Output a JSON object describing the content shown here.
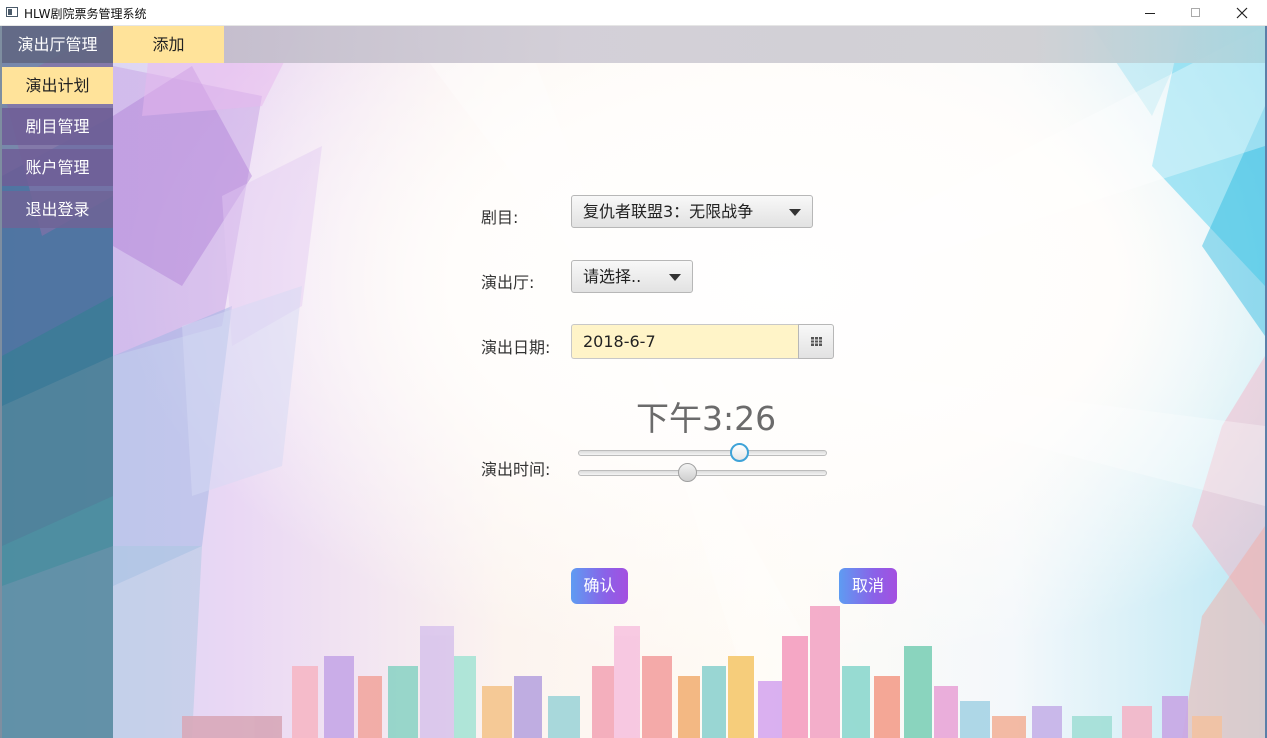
{
  "window": {
    "title": "HLW剧院票务管理系统",
    "controls": [
      "minimize",
      "maximize",
      "close"
    ]
  },
  "topbar": {
    "tabs": [
      {
        "label": "添加",
        "active": true
      }
    ]
  },
  "sidebar": {
    "items": [
      {
        "label": "演出厅管理",
        "active": false
      },
      {
        "label": "演出计划",
        "active": true
      },
      {
        "label": "剧目管理",
        "active": false
      },
      {
        "label": "账户管理",
        "active": false
      },
      {
        "label": "退出登录",
        "active": false
      }
    ]
  },
  "form": {
    "play_label": "剧目:",
    "play_value": "复仇者联盟3：无限战争",
    "hall_label": "演出厅:",
    "hall_value": "请选择..",
    "date_label": "演出日期:",
    "date_value": "2018-6-7",
    "time_label": "演出时间:",
    "time_display": "下午3:26",
    "hour_slider_fraction": 0.65,
    "minute_slider_fraction": 0.44,
    "confirm_label": "确认",
    "cancel_label": "取消"
  },
  "colors": {
    "active_tab": "#ffe39a",
    "date_field_bg": "#fff4c8",
    "button_gradient_start": "#5e9cf2",
    "button_gradient_end": "#a44fe0",
    "slider_focus": "#3fa3d8"
  },
  "icons": [
    "app-icon",
    "calendar-icon",
    "chevron-down-icon"
  ]
}
